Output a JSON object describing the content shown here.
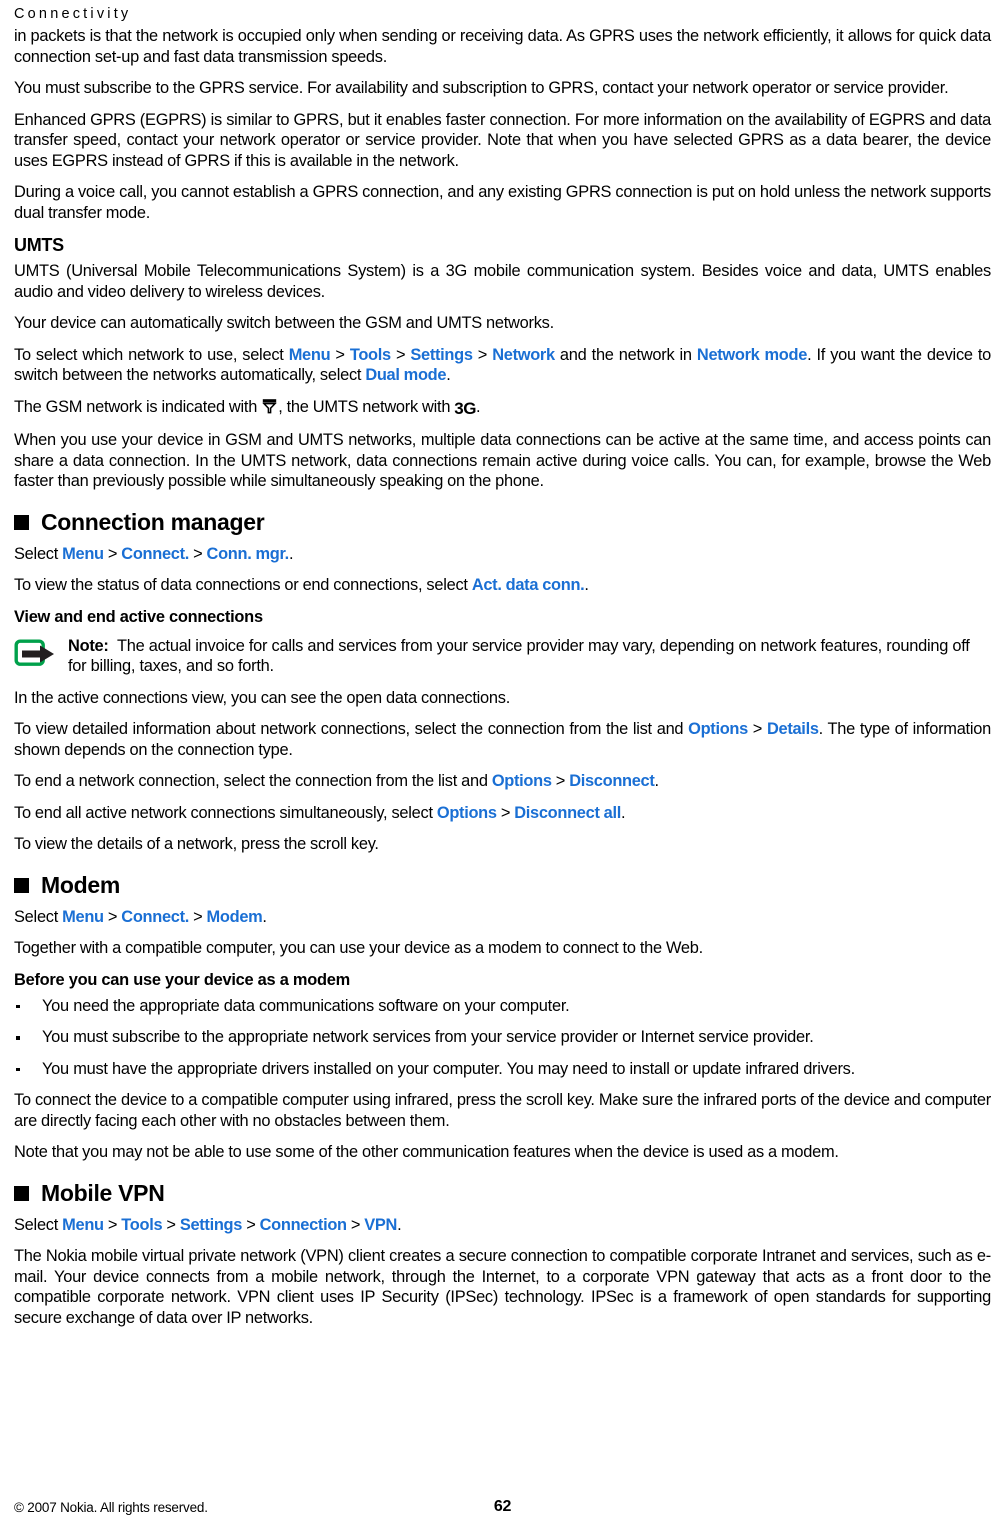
{
  "header": {
    "running_title": "Connectivity"
  },
  "intro": {
    "p1": "in packets is that the network is occupied only when sending or receiving data. As GPRS uses the network efficiently, it allows for quick data connection set-up and fast data transmission speeds.",
    "p2": "You must subscribe to the GPRS service. For availability and subscription to GPRS, contact your network operator or service provider.",
    "p3": "Enhanced GPRS (EGPRS) is similar to GPRS, but it enables faster connection. For more information on the availability of EGPRS and data transfer speed, contact your network operator or service provider. Note that when you have selected GPRS as a data bearer, the device uses EGPRS instead of GPRS if this is available in the network.",
    "p4": "During a voice call, you cannot establish a GPRS connection, and any existing GPRS connection is put on hold unless the network supports dual transfer mode."
  },
  "umts": {
    "heading": "UMTS",
    "p1": "UMTS (Universal Mobile Telecommunications System) is a 3G mobile communication system. Besides voice and data, UMTS enables audio and video delivery to wireless devices.",
    "p2": "Your device can automatically switch between the GSM and UMTS networks.",
    "p3_a": "To select which network to use, select ",
    "link_menu": "Menu",
    "link_tools": "Tools",
    "link_settings": "Settings",
    "link_network": "Network",
    "p3_b": " and the network in ",
    "link_network_mode": "Network mode",
    "p3_c": ". If you want the device to switch between the networks automatically, select ",
    "link_dual_mode": "Dual mode",
    "p3_d": ".",
    "p4_a": "The GSM network is indicated with ",
    "p4_b": ", the UMTS network with ",
    "icon_3g_label": "3G",
    "p4_c": ".",
    "p5": "When you use your device in GSM and UMTS networks, multiple data connections can be active at the same time, and access points can share a data connection. In the UMTS network, data connections remain active during voice calls. You can, for example, browse the Web faster than previously possible while simultaneously speaking on the phone."
  },
  "connection_manager": {
    "heading": "Connection manager",
    "select_prefix": "Select ",
    "link_menu": "Menu",
    "link_connect": "Connect.",
    "link_conn_mgr": "Conn. mgr.",
    "select_suffix": ".",
    "p2_a": "To view the status of data connections or end connections, select ",
    "link_act_data_conn": "Act. data conn.",
    "p2_b": ".",
    "sub_heading": "View and end active connections",
    "note_label": "Note:",
    "note_text": "The actual invoice for calls and services from your service provider may vary, depending on network features, rounding off for billing, taxes, and so forth.",
    "p3": "In the active connections view, you can see the open data connections.",
    "p4_a": "To view detailed information about network connections, select the connection from the list and ",
    "link_options": "Options",
    "link_details": "Details",
    "p4_b": ". The type of information shown depends on the connection type.",
    "p5_a": "To end a network connection, select the connection from the list and ",
    "link_options2": "Options",
    "link_disconnect": "Disconnect",
    "p5_b": ".",
    "p6_a": "To end all active network connections simultaneously, select ",
    "link_options3": "Options",
    "link_disconnect_all": "Disconnect all",
    "p6_b": ".",
    "p7": "To view the details of a network, press the scroll key."
  },
  "modem": {
    "heading": "Modem",
    "select_prefix": "Select ",
    "link_menu": "Menu",
    "link_connect": "Connect.",
    "link_modem": "Modem",
    "select_suffix": ".",
    "p1": "Together with a compatible computer, you can use your device as a modem to connect to the Web.",
    "sub_heading": "Before you can use your device as a modem",
    "bullets": [
      "You need the appropriate data communications software on your computer.",
      "You must subscribe to the appropriate network services from your service provider or Internet service provider.",
      "You must have the appropriate drivers installed on your computer. You may need to install or update infrared drivers."
    ],
    "p2": "To connect the device to a compatible computer using infrared, press the scroll key. Make sure the infrared ports of the device and computer are directly facing each other with no obstacles between them.",
    "p3": "Note that you may not be able to use some of the other communication features when the device is used as a modem."
  },
  "mobile_vpn": {
    "heading": "Mobile VPN",
    "select_prefix": "Select ",
    "link_menu": "Menu",
    "link_tools": "Tools",
    "link_settings": "Settings",
    "link_connection": "Connection",
    "link_vpn": "VPN",
    "select_suffix": ".",
    "p1": "The Nokia mobile virtual private network (VPN) client creates a secure connection to compatible corporate Intranet and services, such as e-mail. Your device connects from a mobile network, through the Internet, to a corporate VPN gateway that acts as a front door to the compatible corporate network. VPN client uses IP Security (IPSec) technology. IPSec is a framework of open standards for supporting secure exchange of data over IP networks."
  },
  "footer": {
    "copyright": "© 2007 Nokia. All rights reserved.",
    "page_number": "62"
  },
  "colors": {
    "link_blue": "#1a6fd4",
    "note_icon_green": "#00a14b",
    "text_black": "#000000"
  }
}
